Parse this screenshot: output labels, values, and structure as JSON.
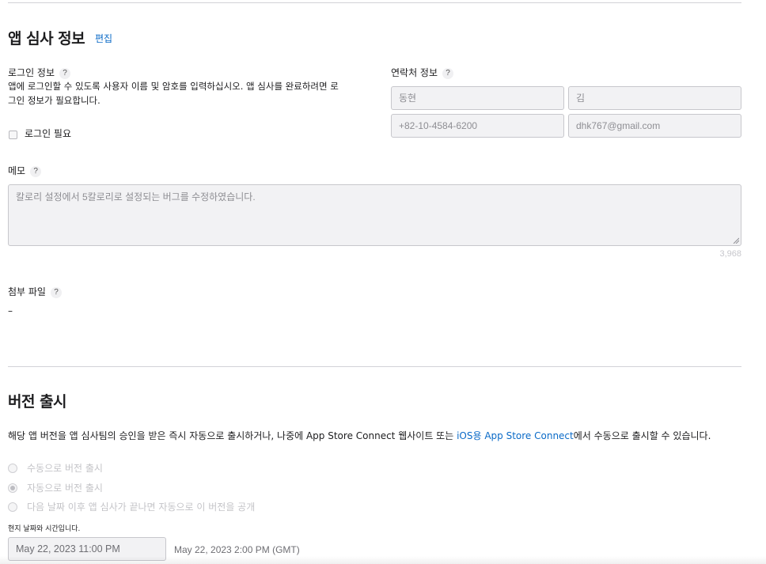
{
  "review": {
    "title": "앱 심사 정보",
    "edit_label": "편집",
    "login": {
      "title": "로그인 정보",
      "help": "?",
      "desc_line1": "앱에 로그인할 수 있도록 사용자 이름 및 암호를 입력하십시오. 앱 심사를 완료하려면 로",
      "desc_line2": "그인 정보가 필요합니다.",
      "required_label": "로그인 필요",
      "required_checked": false
    },
    "contact": {
      "title": "연락처 정보",
      "help": "?",
      "first_name": "동현",
      "last_name": "김",
      "phone": "+82-10-4584-6200",
      "email": "dhk767@gmail.com"
    },
    "notes": {
      "title": "메모",
      "help": "?",
      "value": "칼로리 설정에서 5칼로리로 설정되는 버그를 수정하였습니다.",
      "remaining": "3,968"
    },
    "attachment": {
      "title": "첨부 파일",
      "help": "?",
      "value": "–"
    }
  },
  "release": {
    "title": "버전 출시",
    "desc_prefix": "해당 앱 버전을 앱 심사팀의 승인을 받은 즉시 자동으로 출시하거나, 나중에 App Store Connect 웹사이트 또는 ",
    "desc_link": "iOS용 App Store Connect",
    "desc_suffix": "에서 수동으로 출시할 수 있습니다.",
    "options": [
      {
        "label": "수동으로 버전 출시",
        "selected": false
      },
      {
        "label": "자동으로 버전 출시",
        "selected": true
      },
      {
        "label": "다음 날짜 이후 앱 심사가 끝나면 자동으로 이 버전을 공개",
        "selected": false
      }
    ],
    "local_time_note": "현지 날짜와 시간입니다.",
    "date_value": "May 22, 2023 11:00 PM",
    "gmt_text": "May 22, 2023 2:00 PM (GMT)"
  },
  "colors": {
    "link": "#0a6ac7",
    "rule": "#d2d2d7",
    "field_bg": "#f2f2f4"
  }
}
